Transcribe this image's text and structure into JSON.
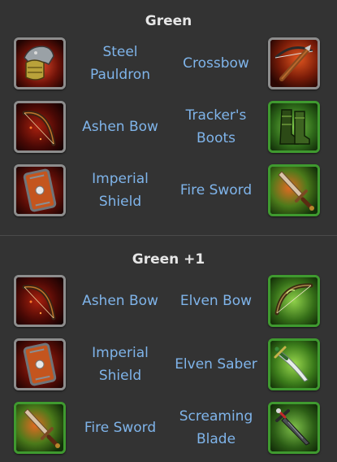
{
  "sections": [
    {
      "title": "Green",
      "rows": [
        {
          "left": {
            "name": "Steel Pauldron",
            "icon": "steel-pauldron-icon",
            "frame": "grey"
          },
          "right": {
            "name": "Crossbow",
            "icon": "crossbow-icon",
            "frame": "grey"
          }
        },
        {
          "left": {
            "name": "Ashen Bow",
            "icon": "ashen-bow-icon",
            "frame": "grey"
          },
          "right": {
            "name": "Tracker's Boots",
            "icon": "trackers-boots-icon",
            "frame": "green"
          }
        },
        {
          "left": {
            "name": "Imperial Shield",
            "icon": "imperial-shield-icon",
            "frame": "grey"
          },
          "right": {
            "name": "Fire Sword",
            "icon": "fire-sword-icon",
            "frame": "green"
          }
        }
      ]
    },
    {
      "title": "Green +1",
      "rows": [
        {
          "left": {
            "name": "Ashen Bow",
            "icon": "ashen-bow-icon",
            "frame": "grey"
          },
          "right": {
            "name": "Elven Bow",
            "icon": "elven-bow-icon",
            "frame": "green"
          }
        },
        {
          "left": {
            "name": "Imperial Shield",
            "icon": "imperial-shield-icon",
            "frame": "grey"
          },
          "right": {
            "name": "Elven Saber",
            "icon": "elven-saber-icon",
            "frame": "green"
          }
        },
        {
          "left": {
            "name": "Fire Sword",
            "icon": "fire-sword-icon",
            "frame": "green"
          },
          "right": {
            "name": "Screaming Blade",
            "icon": "screaming-blade-icon",
            "frame": "green"
          }
        }
      ]
    }
  ],
  "colors": {
    "background": "#333333",
    "title": "#e6e6e6",
    "item_name": "#7fb4ea",
    "frame_grey": "#8d8d8d",
    "frame_green": "#3f9a2f"
  }
}
